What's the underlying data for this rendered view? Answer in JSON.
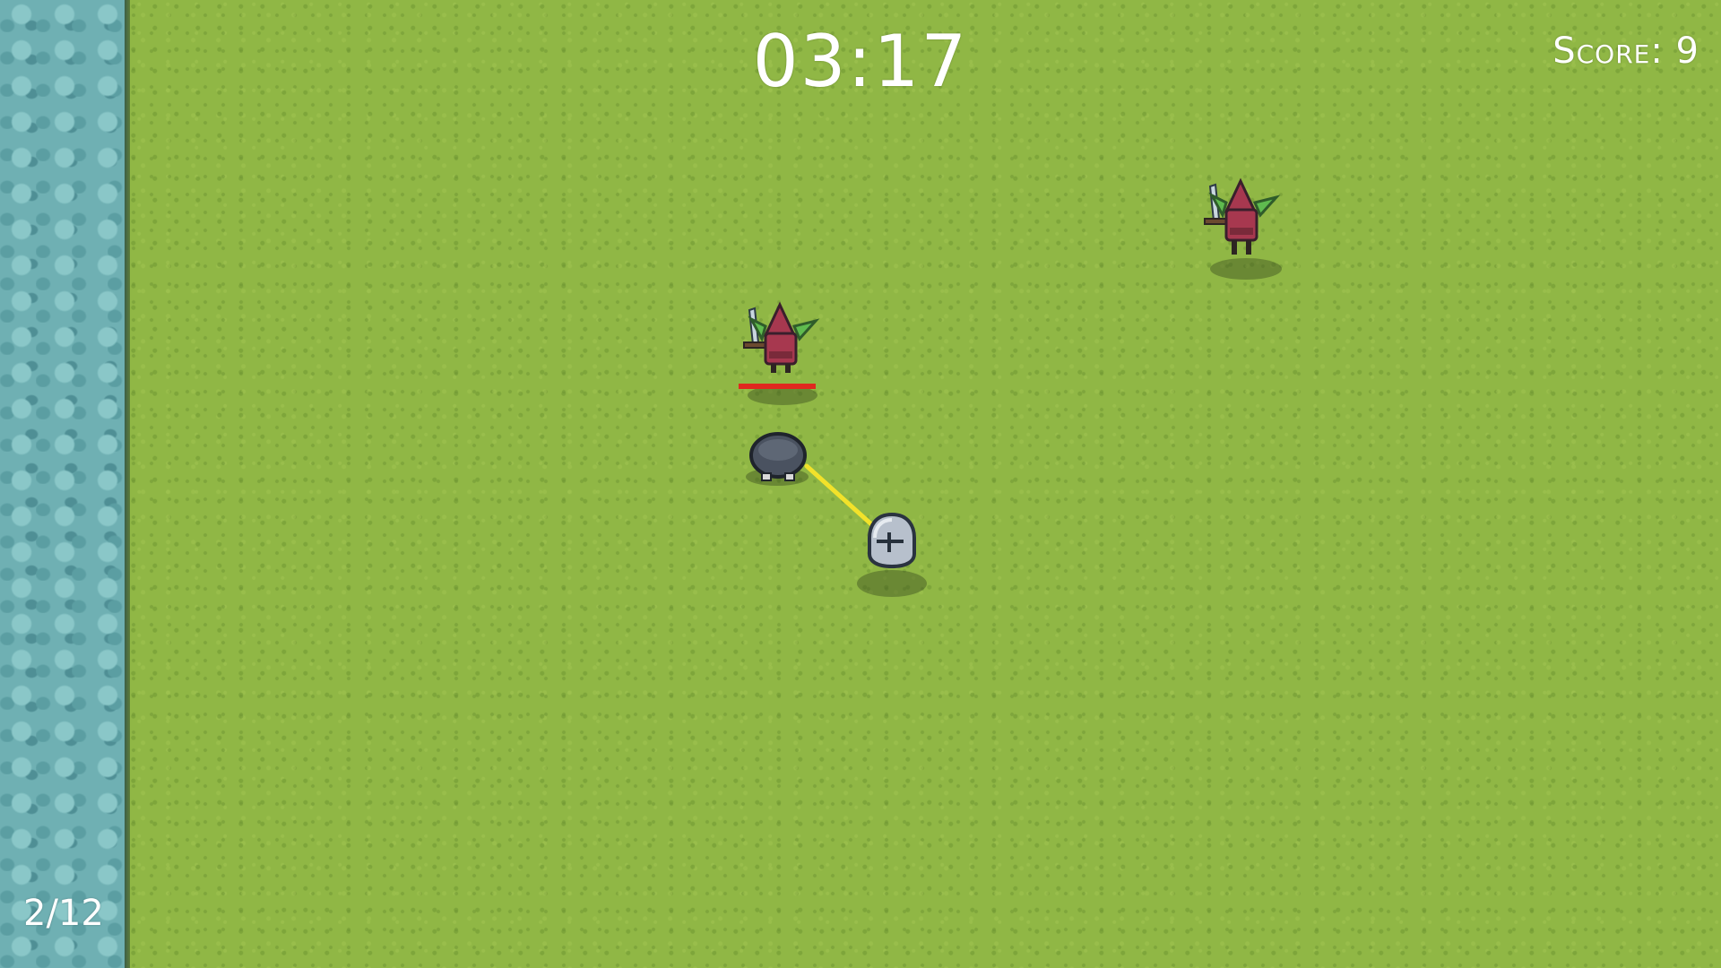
{
  "hud": {
    "timer": "03:17",
    "score_text": "Score: 9",
    "wave_text": "2/12"
  },
  "entities": {
    "player": {
      "icon": "hooded-player-icon"
    },
    "enemies": [
      {
        "icon": "goblin-swordsman-icon",
        "health_fraction": 1.0,
        "health_bar_visible": false
      },
      {
        "icon": "goblin-swordsman-icon",
        "health_fraction": 1.0,
        "health_bar_visible": true
      }
    ],
    "tether": {
      "icon": "yellow-tether-line",
      "color": "#f2e22a"
    },
    "helmet": {
      "icon": "knight-helmet-icon"
    }
  },
  "colors": {
    "grass": "#90b745",
    "water": "#6fb0b3",
    "health_bar": "#e0281f",
    "hud_text": "#ffffff"
  }
}
